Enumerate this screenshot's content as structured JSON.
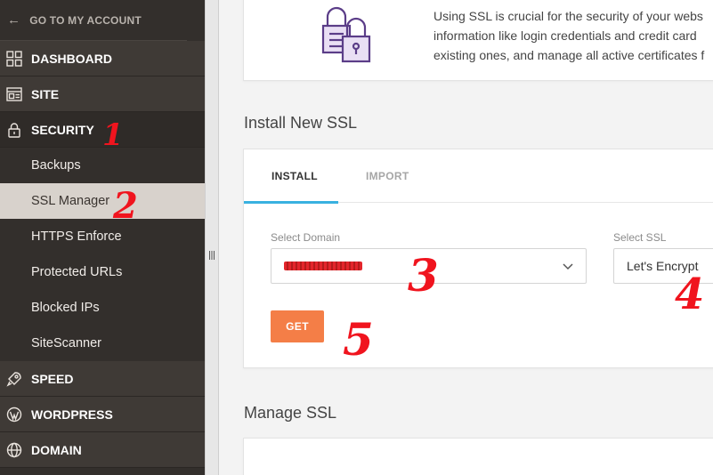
{
  "sidebar": {
    "go_back_label": "GO TO MY ACCOUNT",
    "items": [
      {
        "label": "DASHBOARD",
        "icon": "grid-icon"
      },
      {
        "label": "SITE",
        "icon": "window-icon"
      },
      {
        "label": "SECURITY",
        "icon": "lock-icon"
      }
    ],
    "security_sub": [
      "Backups",
      "SSL Manager",
      "HTTPS Enforce",
      "Protected URLs",
      "Blocked IPs",
      "SiteScanner"
    ],
    "active_sub": "SSL Manager",
    "bottom_items": [
      {
        "label": "SPEED",
        "icon": "rocket-icon"
      },
      {
        "label": "WORDPRESS",
        "icon": "wordpress-icon"
      },
      {
        "label": "DOMAIN",
        "icon": "globe-icon"
      }
    ]
  },
  "intro": {
    "line1": "Using SSL is crucial for the security of your webs",
    "line2": "information like login credentials and credit card",
    "line3": "existing ones, and manage all active certificates f"
  },
  "install_section": {
    "title": "Install New SSL",
    "tabs": [
      "INSTALL",
      "IMPORT"
    ],
    "active_tab": "INSTALL",
    "domain_label": "Select Domain",
    "ssl_label": "Select SSL",
    "ssl_value": "Let's Encrypt",
    "get_label": "GET"
  },
  "manage_section": {
    "title": "Manage SSL"
  },
  "annotations": [
    "1",
    "2",
    "3",
    "4",
    "5"
  ],
  "colors": {
    "sidebar_bg": "#332f2c",
    "active_sub_bg": "#d8d2cc",
    "accent_tab": "#39b1e0",
    "get_button": "#f47e47",
    "annotation_red": "#f0141e"
  }
}
